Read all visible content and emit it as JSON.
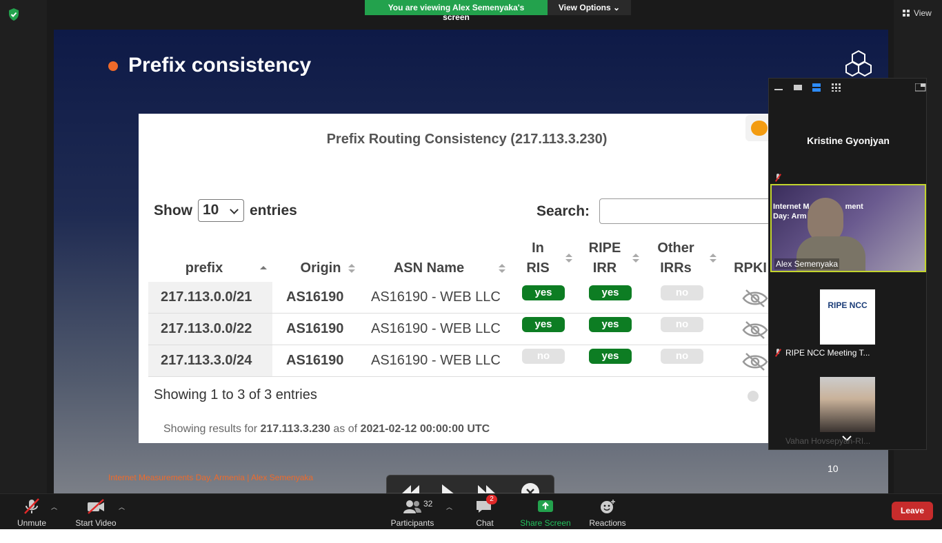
{
  "share_banner": {
    "message": "You are viewing Alex Semenyaka's screen",
    "options_label": "View Options"
  },
  "view_button": {
    "label": "View"
  },
  "slide": {
    "title": "Prefix consistency",
    "footer": "Internet Measurements Day, Armenia | Alex Semenyaka",
    "card": {
      "title": "Prefix Routing Consistency (217.113.3.230)",
      "show_label": "Show",
      "entries_value": "10",
      "entries_label": "entries",
      "search_label": "Search:",
      "columns": {
        "prefix": "prefix",
        "origin": "Origin",
        "asn_name": "ASN Name",
        "in_ris_1": "In",
        "in_ris_2": "RIS",
        "ripe_irr_1": "RIPE",
        "ripe_irr_2": "IRR",
        "other_irrs_1": "Other",
        "other_irrs_2": "IRRs",
        "rpki": "RPKI"
      },
      "rows": [
        {
          "prefix": "217.113.0.0/21",
          "origin": "AS16190",
          "asn_name": "AS16190 - WEB LLC",
          "in_ris": "yes",
          "ripe_irr": "yes",
          "other_irrs": "no"
        },
        {
          "prefix": "217.113.0.0/22",
          "origin": "AS16190",
          "asn_name": "AS16190 - WEB LLC",
          "in_ris": "yes",
          "ripe_irr": "yes",
          "other_irrs": "no"
        },
        {
          "prefix": "217.113.3.0/24",
          "origin": "AS16190",
          "asn_name": "AS16190 - WEB LLC",
          "in_ris": "no",
          "ripe_irr": "yes",
          "other_irrs": "no"
        }
      ],
      "showing": "Showing 1 to 3 of 3 entries",
      "results_prefix": "Showing results for",
      "results_ip": "217.113.3.230",
      "results_mid": "as of",
      "results_date": "2021-02-12 00:00:00 UTC"
    }
  },
  "gallery": {
    "speaker_name": "Kristine Gyonjyan",
    "active_tile": {
      "name": "Alex Semenyaka",
      "bg_text_1": "Internet M",
      "bg_text_2": "ment",
      "bg_text_3": "Day: Arm"
    },
    "tile2": {
      "name": "RIPE NCC Meeting T...",
      "logo_text": "RIPE NCC"
    },
    "tile3": {
      "name": "Vahan Hovsepyan-RI..."
    },
    "count": "10"
  },
  "toolbar": {
    "unmute": "Unmute",
    "start_video": "Start Video",
    "participants": "Participants",
    "participants_count": "32",
    "chat": "Chat",
    "chat_badge": "2",
    "share_screen": "Share Screen",
    "reactions": "Reactions",
    "leave": "Leave"
  }
}
